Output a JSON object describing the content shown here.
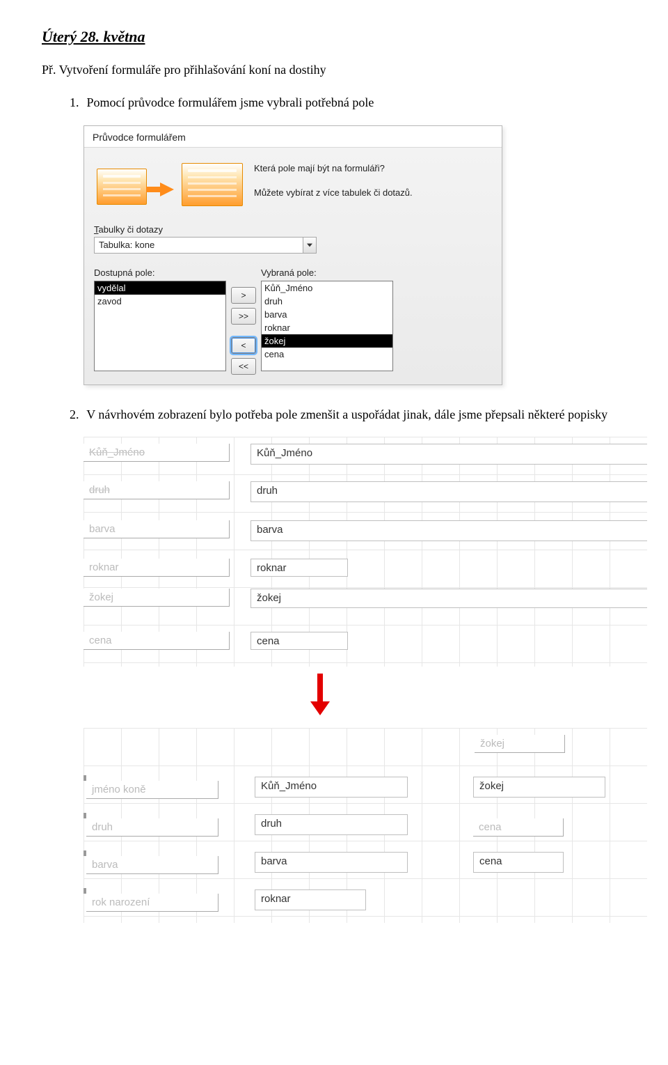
{
  "heading": "Úterý 28. května",
  "intro": "Př. Vytvoření formuláře pro přihlašování koní na dostihy",
  "item1_num": "1.",
  "item1_text": "Pomocí průvodce formulářem jsme vybrali potřebná pole",
  "item2_num": "2.",
  "item2_text": "V návrhovém zobrazení bylo potřeba pole zmenšit a uspořádat jinak, dále jsme přepsali některé popisky",
  "wizard": {
    "title": "Průvodce formulářem",
    "q1": "Která pole mají být na formuláři?",
    "q2": "Můžete vybírat z více tabulek či dotazů.",
    "tables_label_pre": "T",
    "tables_label_rest": "abulky či dotazy",
    "combo_value": "Tabulka: kone",
    "available_label": "Dostupná pole:",
    "selected_label": "Vybraná pole:",
    "available": [
      {
        "label": "vydělal",
        "selected": true
      },
      {
        "label": "zavod",
        "selected": false
      }
    ],
    "buttons": {
      "add": ">",
      "add_all": ">>",
      "remove": "<",
      "remove_all": "<<"
    },
    "selected": [
      {
        "label": "Kůň_Jméno",
        "selected": false
      },
      {
        "label": "druh",
        "selected": false
      },
      {
        "label": "barva",
        "selected": false
      },
      {
        "label": "roknar",
        "selected": false
      },
      {
        "label": "žokej",
        "selected": true
      },
      {
        "label": "cena",
        "selected": false
      }
    ]
  },
  "design1": {
    "rows": [
      {
        "label": "Kůň_Jméno",
        "field": "Kůň_Jméno",
        "strike": true
      },
      {
        "label": "druh",
        "field": "druh",
        "strike": true
      },
      {
        "label": "barva",
        "field": "barva",
        "strike": false
      },
      {
        "label": "roknar",
        "field": "roknar",
        "strike": false
      },
      {
        "label": "žokej",
        "field": "žokej",
        "strike": false
      },
      {
        "label": "cena",
        "field": "cena",
        "strike": false
      }
    ]
  },
  "design2": {
    "top_right_label": "žokej",
    "rows": [
      {
        "label": "jméno koně",
        "field": "Kůň_Jméno",
        "right_field": "žokej"
      },
      {
        "label": "druh",
        "field": "druh",
        "right_field": "cena"
      },
      {
        "label": "barva",
        "field": "barva",
        "right_field": "cena"
      },
      {
        "label": "rok narození",
        "field": "roknar",
        "right_field": ""
      }
    ]
  }
}
